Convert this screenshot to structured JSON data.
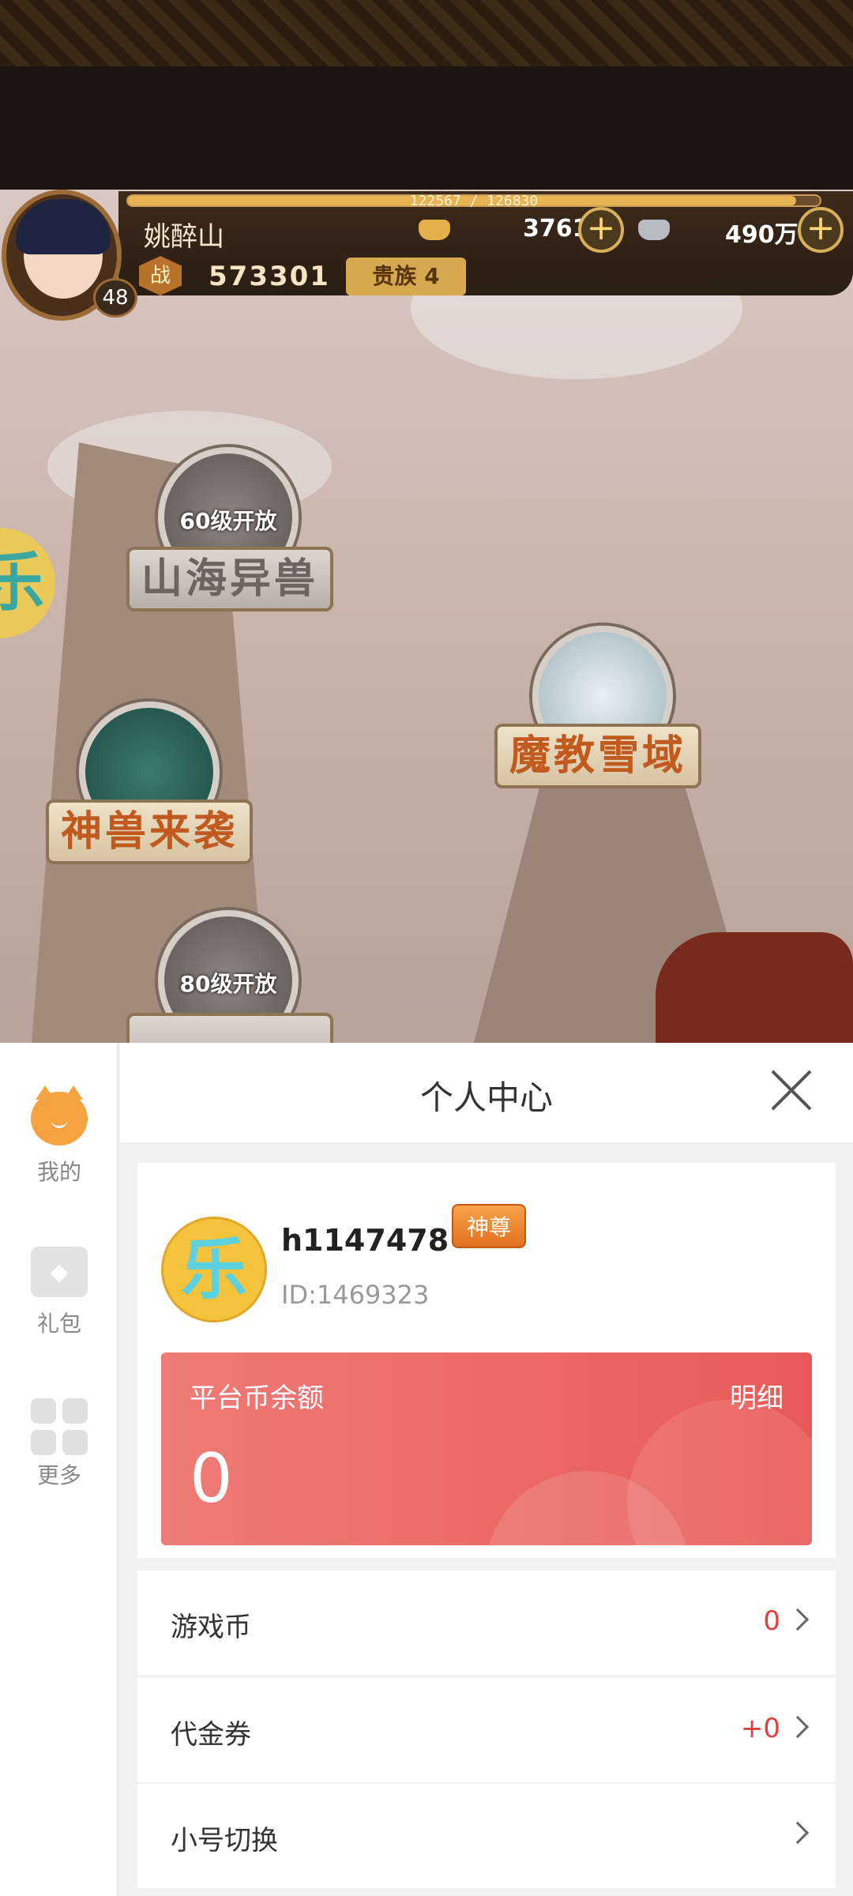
{
  "game": {
    "exp_text": "122567 / 126830",
    "exp_progress": 0.966,
    "player_name": "姚醉山",
    "level": "48",
    "gold": "3761",
    "silver": "490万",
    "power_icon": "战",
    "power": "573301",
    "noble": "贵族 4",
    "side_float_char": "乐",
    "nodes": [
      {
        "name": "山海异兽",
        "lock_text": "60级开放",
        "state": "locked"
      },
      {
        "name": "魔教雪域",
        "lock_text": "",
        "state": "active"
      },
      {
        "name": "神兽来袭",
        "lock_text": "",
        "state": "active"
      },
      {
        "name": "",
        "lock_text": "80级开放",
        "state": "locked"
      }
    ]
  },
  "sheet": {
    "nav": [
      {
        "label": "我的",
        "icon": "cat-icon"
      },
      {
        "label": "礼包",
        "icon": "gift-icon"
      },
      {
        "label": "更多",
        "icon": "more-grid-icon"
      }
    ],
    "title": "个人中心",
    "user": {
      "avatar_char": "乐",
      "username": "h1147478",
      "vip": "神尊",
      "id": "ID:1469323"
    },
    "balance": {
      "label": "平台币余额",
      "detail": "明细",
      "value": "0"
    },
    "rows": [
      {
        "label": "游戏币",
        "value": "0"
      },
      {
        "label": "代金券",
        "value": "+0"
      },
      {
        "label": "小号切换",
        "value": ""
      }
    ]
  },
  "colors": {
    "accent_red": "#e85a57",
    "value_red": "#e0423b",
    "nav_cat": "#f5a341"
  }
}
